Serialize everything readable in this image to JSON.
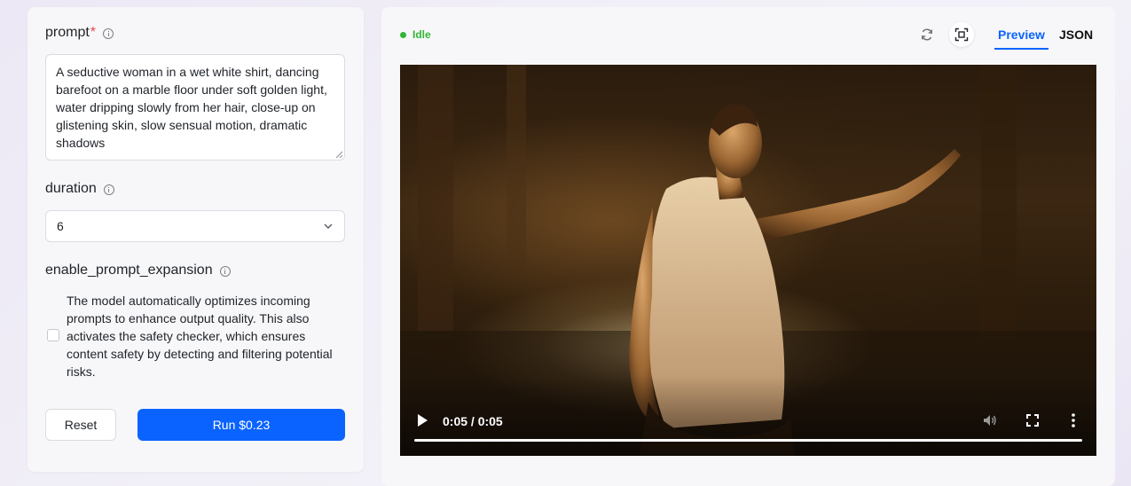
{
  "form": {
    "prompt_label": "prompt",
    "prompt_required": "*",
    "prompt_value": "A seductive woman in a wet white shirt, dancing barefoot on a marble floor under soft golden light, water dripping slowly from her hair, close-up on glistening skin, slow sensual motion, dramatic shadows",
    "duration_label": "duration",
    "duration_value": "6",
    "expansion_label": "enable_prompt_expansion",
    "expansion_description": "The model automatically optimizes incoming prompts to enhance output quality. This also activates the safety checker, which ensures content safety by detecting and filtering potential risks.",
    "expansion_checked": false,
    "reset_label": "Reset",
    "run_label": "Run $0.23"
  },
  "preview": {
    "status": "Idle",
    "status_color": "#31b536",
    "tabs": [
      {
        "label": "Preview",
        "active": true
      },
      {
        "label": "JSON",
        "active": false
      }
    ],
    "video": {
      "time": "0:05 / 0:05",
      "progress": 1.0
    },
    "icons": [
      "refresh-icon",
      "fit-screen-icon",
      "play-icon",
      "volume-icon",
      "fullscreen-icon",
      "more-vertical-icon"
    ]
  },
  "colors": {
    "accent": "#0a63ff",
    "required": "#e5484d"
  }
}
